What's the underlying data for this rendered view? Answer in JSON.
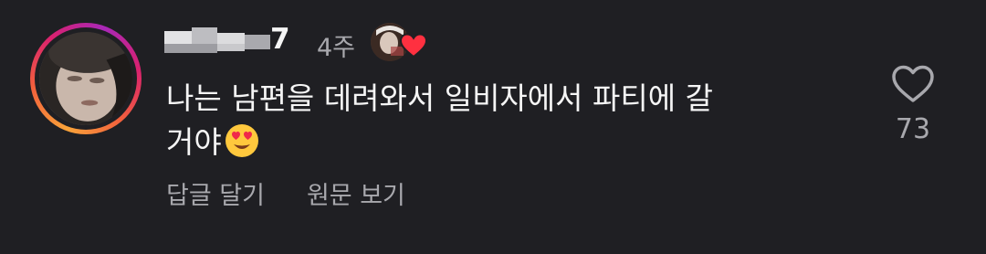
{
  "comment": {
    "username_visible": "7",
    "timestamp": "4주",
    "text_line1": "나는 남편을 데려와서 일비자에서 파티에 갈",
    "text_line2": "거야",
    "text_emoji": "😍",
    "actions": {
      "reply_label": "답글 달기",
      "see_original_label": "원문 보기"
    },
    "like": {
      "count": "73",
      "icon": "heart-outline-icon"
    },
    "creator_reaction_icon": "heart-filled-icon"
  },
  "colors": {
    "background": "#1f1f23",
    "primary_text": "#f5f5f5",
    "secondary_text": "#a8a8ad",
    "heart_red": "#ff3040"
  }
}
